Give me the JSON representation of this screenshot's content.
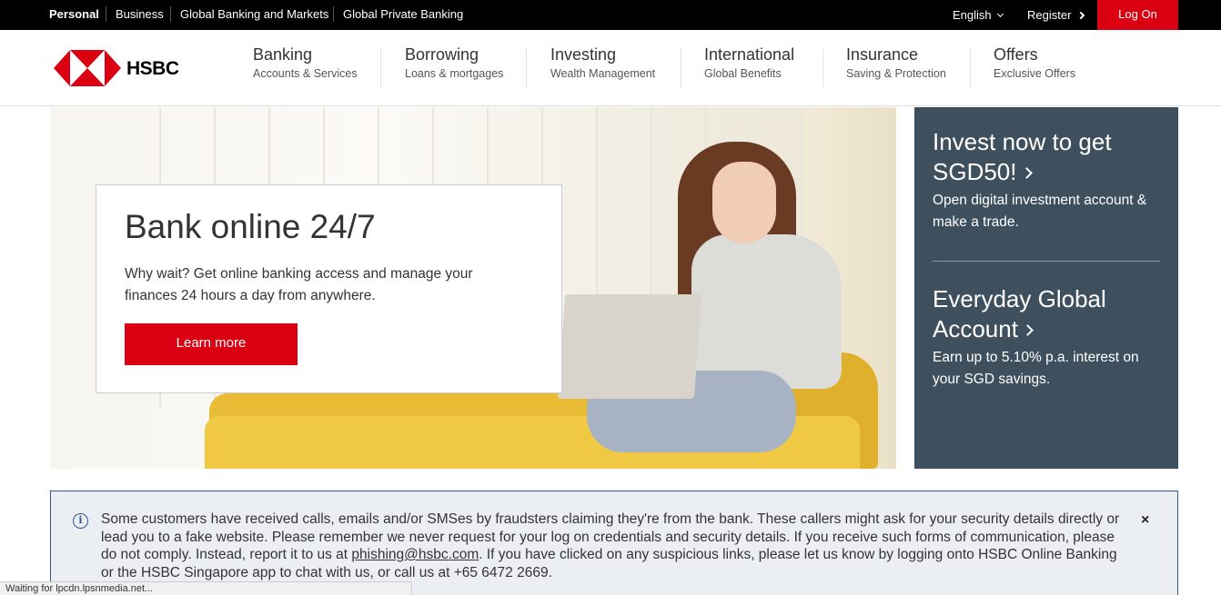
{
  "topbar": {
    "segments": [
      "Personal",
      "Business",
      "Global Banking and Markets",
      "Global Private Banking"
    ],
    "language": "English",
    "register": "Register",
    "login": "Log On"
  },
  "header": {
    "logo_text": "HSBC",
    "nav": [
      {
        "title": "Banking",
        "subtitle": "Accounts & Services"
      },
      {
        "title": "Borrowing",
        "subtitle": "Loans & mortgages"
      },
      {
        "title": "Investing",
        "subtitle": "Wealth Management"
      },
      {
        "title": "International",
        "subtitle": "Global Benefits"
      },
      {
        "title": "Insurance",
        "subtitle": "Saving & Protection"
      },
      {
        "title": "Offers",
        "subtitle": "Exclusive Offers"
      }
    ]
  },
  "hero": {
    "title": "Bank online 24/7",
    "body": "Why wait? Get online banking access and manage your finances 24 hours a day from anywhere.",
    "cta": "Learn more"
  },
  "side": {
    "promos": [
      {
        "title_lines": [
          "Invest now to get",
          "SGD50!"
        ],
        "desc": "Open digital investment account & make a trade."
      },
      {
        "title_lines": [
          "Everyday Global",
          "Account"
        ],
        "desc": "Earn up to 5.10% p.a. interest on your SGD savings."
      }
    ]
  },
  "notice": {
    "text_before": "Some customers have received calls, emails and/or SMSes by fraudsters claiming they're from the bank. These callers might ask for your security details directly or lead you to a fake website. Please remember we never request for your log on credentials and security details. If you receive such forms of communication, please do not comply. Instead, report it to us at ",
    "email": "phishing@hsbc.com",
    "text_after": ". If you have clicked on any suspicious links, please let us know by logging onto HSBC Online Banking or the HSBC Singapore app to chat with us, or call us at +65 6472 2669.",
    "close": "×"
  },
  "status_bar": "Waiting for lpcdn.lpsnmedia.net...",
  "colors": {
    "brand_red": "#db0011",
    "panel": "#3e505d",
    "notice_bg": "#ebeff4"
  }
}
